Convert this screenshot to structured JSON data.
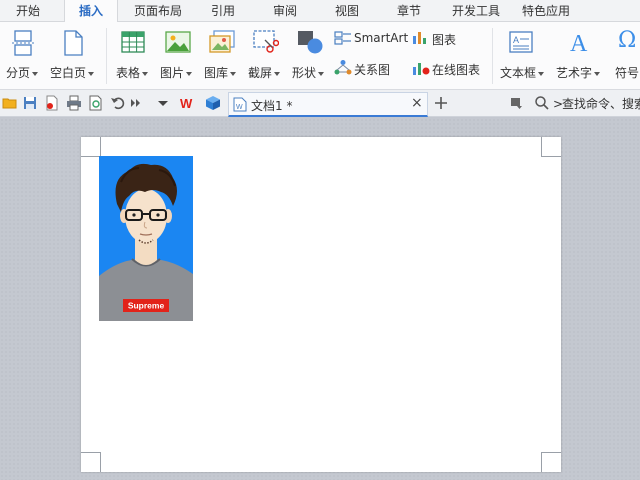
{
  "menu": {
    "tabs": [
      {
        "label": "开始"
      },
      {
        "label": "插入"
      },
      {
        "label": "页面布局"
      },
      {
        "label": "引用"
      },
      {
        "label": "审阅"
      },
      {
        "label": "视图"
      },
      {
        "label": "章节"
      },
      {
        "label": "开发工具"
      },
      {
        "label": "特色应用"
      }
    ],
    "active_tab": "插入"
  },
  "ribbon": {
    "page_break": "分页",
    "blank_page": "空白页",
    "table": "表格",
    "picture": "图片",
    "gallery": "图库",
    "screenshot": "截屏",
    "shapes": "形状",
    "smartart": "SmartArt",
    "relation_chart": "关系图",
    "chart": "图表",
    "online_chart": "在线图表",
    "textbox": "文本框",
    "wordart": "艺术字",
    "symbol": "符号",
    "symbol_glyph": "Ω"
  },
  "doc_tab": {
    "title": "文档1 *"
  },
  "search": {
    "label": "查找命令、搜索"
  },
  "photo": {
    "shirt_text": "Supreme"
  },
  "colors": {
    "accent": "#2b6cc4",
    "photo_bg": "#1b86f2",
    "logo_red": "#e2231a"
  }
}
